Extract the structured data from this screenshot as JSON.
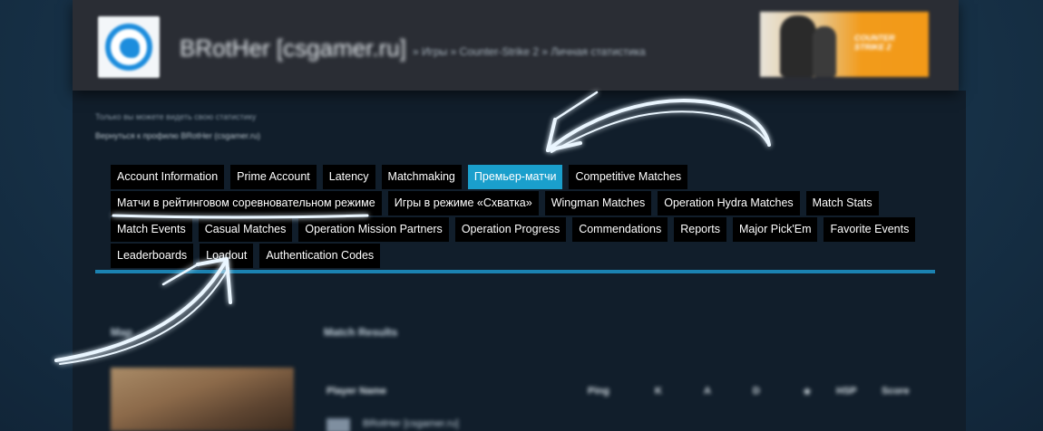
{
  "header": {
    "profile_name": "BRotHer [csgamer.ru]",
    "breadcrumb": "» Игры » Counter-Strike 2 » Личная статистика",
    "banner_text": "COUNTER STRIKE 2"
  },
  "notes": {
    "line1": "Только вы можете видеть свою статистику",
    "line2": "Вернуться к профилю BRotHer (csgamer.ru)"
  },
  "tabs": {
    "row1": [
      "Account Information",
      "Prime Account",
      "Latency",
      "Matchmaking",
      "Премьер-матчи",
      "Competitive Matches"
    ],
    "row2": [
      "Матчи в рейтинговом соревновательном режиме",
      "Игры в режиме «Схватка»",
      "Wingman Matches",
      "Operation Hydra Matches",
      "Match Stats"
    ],
    "row3": [
      "Match Events",
      "Casual Matches",
      "Operation Mission Partners",
      "Operation Progress",
      "Commendations",
      "Reports",
      "Major Pick'Em",
      "Favorite Events"
    ],
    "row4": [
      "Leaderboards",
      "Loadout",
      "Authentication Codes"
    ],
    "active": "Премьер-матчи"
  },
  "table": {
    "map_header": "Map",
    "results_header": "Match Results",
    "columns": [
      "Player Name",
      "Ping",
      "K",
      "A",
      "D",
      "★",
      "HSP",
      "Score"
    ],
    "first_player": "BRotHer [csgamer.ru]"
  },
  "colors": {
    "page_bg": "#1b3a52",
    "header_bg": "#2a2d34",
    "tab_bg": "#000000",
    "tab_active": "#1a9fcc",
    "rule": "#1b82b1",
    "annotation": "#eaf6ff"
  }
}
